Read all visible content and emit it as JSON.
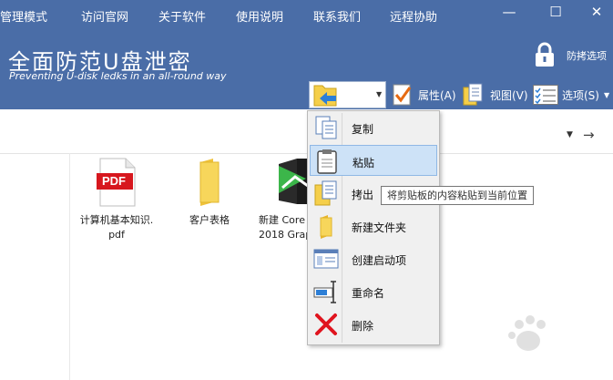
{
  "menubar": {
    "items": [
      "管理模式",
      "访问官网",
      "关于软件",
      "使用说明",
      "联系我们",
      "远程协助"
    ]
  },
  "window_controls": {
    "minimize": "—",
    "maximize": "☐",
    "close": "✕"
  },
  "app": {
    "title": "全面防范U盘泄密",
    "subtitle": "Preventing U-disk ledks in an all-round way"
  },
  "lock": {
    "label": "防拷选项"
  },
  "toolbar": {
    "properties_label": "属性(A)",
    "view_label": "视图(V)",
    "options_label": "选项(S)"
  },
  "files": [
    {
      "name_line1": "计算机基本知识.",
      "name_line2": "pdf",
      "icon": "pdf-icon",
      "icon_text": "PDF"
    },
    {
      "name_line1": "客户表格",
      "name_line2": "",
      "icon": "folder-icon"
    },
    {
      "name_line1": "新建 Core",
      "name_line2": "2018 Grap",
      "icon": "coreldraw-icon"
    }
  ],
  "context_menu": {
    "items": [
      {
        "label": "复制",
        "icon": "copy-icon"
      },
      {
        "label": "粘贴",
        "icon": "paste-icon"
      },
      {
        "label": "拷出",
        "icon": "copy-out-icon"
      },
      {
        "label": "新建文件夹",
        "icon": "new-folder-icon"
      },
      {
        "label": "创建启动项",
        "icon": "startup-icon"
      },
      {
        "label": "重命名",
        "icon": "rename-icon"
      },
      {
        "label": "删除",
        "icon": "delete-icon"
      }
    ],
    "highlighted_index": 1
  },
  "tooltip": {
    "text": "将剪贴板的内容粘贴到当前位置"
  },
  "colors": {
    "header": "#4a6da7",
    "menu_highlight": "#cde2f7",
    "delete_red": "#e0141e"
  }
}
